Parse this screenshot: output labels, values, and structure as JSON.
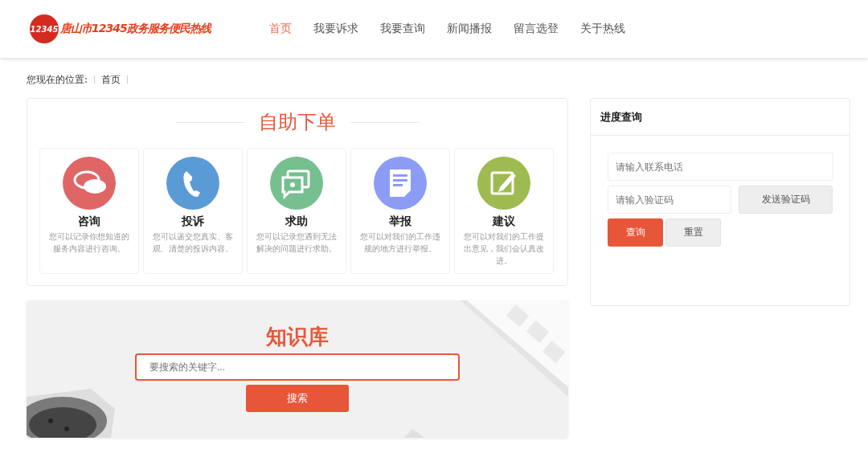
{
  "logo": {
    "mark": "12345",
    "title": "唐山市12345政务服务便民热线"
  },
  "nav": [
    {
      "label": "首页",
      "selected": true
    },
    {
      "label": "我要诉求",
      "selected": false
    },
    {
      "label": "我要查询",
      "selected": false
    },
    {
      "label": "新闻播报",
      "selected": false
    },
    {
      "label": "留言选登",
      "selected": false
    },
    {
      "label": "关于热线",
      "selected": false
    }
  ],
  "breadcrumb": {
    "label": "您现在的位置:",
    "items": [
      "首页"
    ]
  },
  "self_service": {
    "title": "自助下单",
    "cards": [
      {
        "kind": "consult",
        "title": "咨询",
        "text": "您可以记录你想知道的服务内容进行咨询。",
        "color": "#e06666"
      },
      {
        "kind": "complaint",
        "title": "投诉",
        "text": "您可以递交您真实、客观、清楚的投诉内容。",
        "color": "#5b9bd5"
      },
      {
        "kind": "help",
        "title": "求助",
        "text": "您可以记录您遇到无法解决的问题进行求助。",
        "color": "#76bf8f"
      },
      {
        "kind": "report",
        "title": "举报",
        "text": "您可以对我们的工作违规的地方进行举报。",
        "color": "#8c9cf5"
      },
      {
        "kind": "suggest",
        "title": "建议",
        "text": "您可以对我们的工作提出意见，我们会认真改进。",
        "color": "#9dbb50"
      }
    ]
  },
  "knowledge": {
    "title": "知识库",
    "search": {
      "placeholder": "要搜索的关键字..."
    },
    "button": "搜索"
  },
  "progress": {
    "title": "进度查询",
    "phone": {
      "placeholder": "请输入联系电话"
    },
    "code": {
      "placeholder": "请输入验证码"
    },
    "send_button": "发送验证码",
    "query_button": "查询",
    "reset_button": "重置"
  }
}
